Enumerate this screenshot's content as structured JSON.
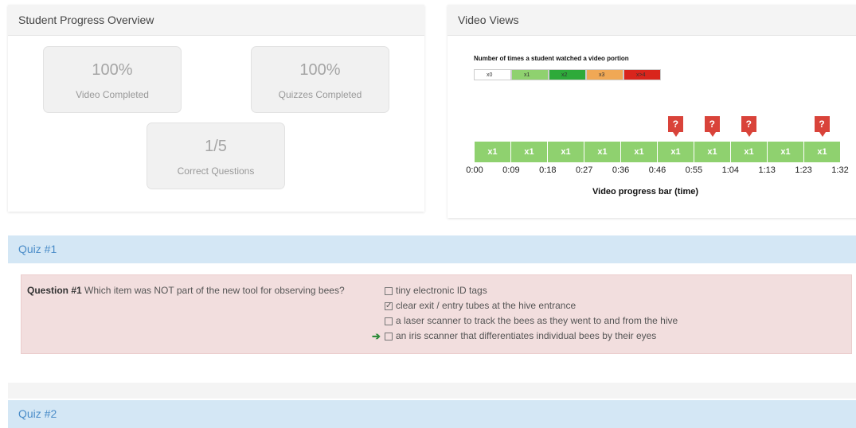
{
  "progress_panel": {
    "title": "Student Progress Overview",
    "stats": [
      {
        "value": "100%",
        "label": "Video Completed"
      },
      {
        "value": "100%",
        "label": "Quizzes Completed"
      },
      {
        "value": "1/5",
        "label": "Correct Questions"
      }
    ]
  },
  "video_panel": {
    "title": "Video Views",
    "legend_title": "Number of times a student watched a video portion",
    "legend": [
      {
        "label": "x0",
        "color": "#ffffff"
      },
      {
        "label": "x1",
        "color": "#8fd16f"
      },
      {
        "label": "x2",
        "color": "#2eaa3a"
      },
      {
        "label": "x3",
        "color": "#f0a855"
      },
      {
        "label": "x>4",
        "color": "#d9251c"
      }
    ],
    "segments": [
      "x1",
      "x1",
      "x1",
      "x1",
      "x1",
      "x1",
      "x1",
      "x1",
      "x1",
      "x1"
    ],
    "question_marker": "?",
    "question_marker_segments": [
      5,
      6,
      7,
      9
    ],
    "ticks": [
      "0:00",
      "0:09",
      "0:18",
      "0:27",
      "0:36",
      "0:46",
      "0:55",
      "1:04",
      "1:13",
      "1:23",
      "1:32"
    ],
    "axis_label": "Video progress bar (time)"
  },
  "quiz1": {
    "title": "Quiz #1",
    "question_number": "Question #1",
    "question_text": "Which item was NOT part of the new tool for observing bees?",
    "answers": [
      {
        "text": "tiny electronic ID tags",
        "checked": false,
        "correct": false
      },
      {
        "text": "clear exit / entry tubes at the hive entrance",
        "checked": true,
        "correct": false
      },
      {
        "text": "a laser scanner to track the bees as they went to and from the hive",
        "checked": false,
        "correct": false
      },
      {
        "text": "an iris scanner that differentiates individual bees by their eyes",
        "checked": false,
        "correct": true
      }
    ]
  },
  "quiz2": {
    "title": "Quiz #2"
  }
}
